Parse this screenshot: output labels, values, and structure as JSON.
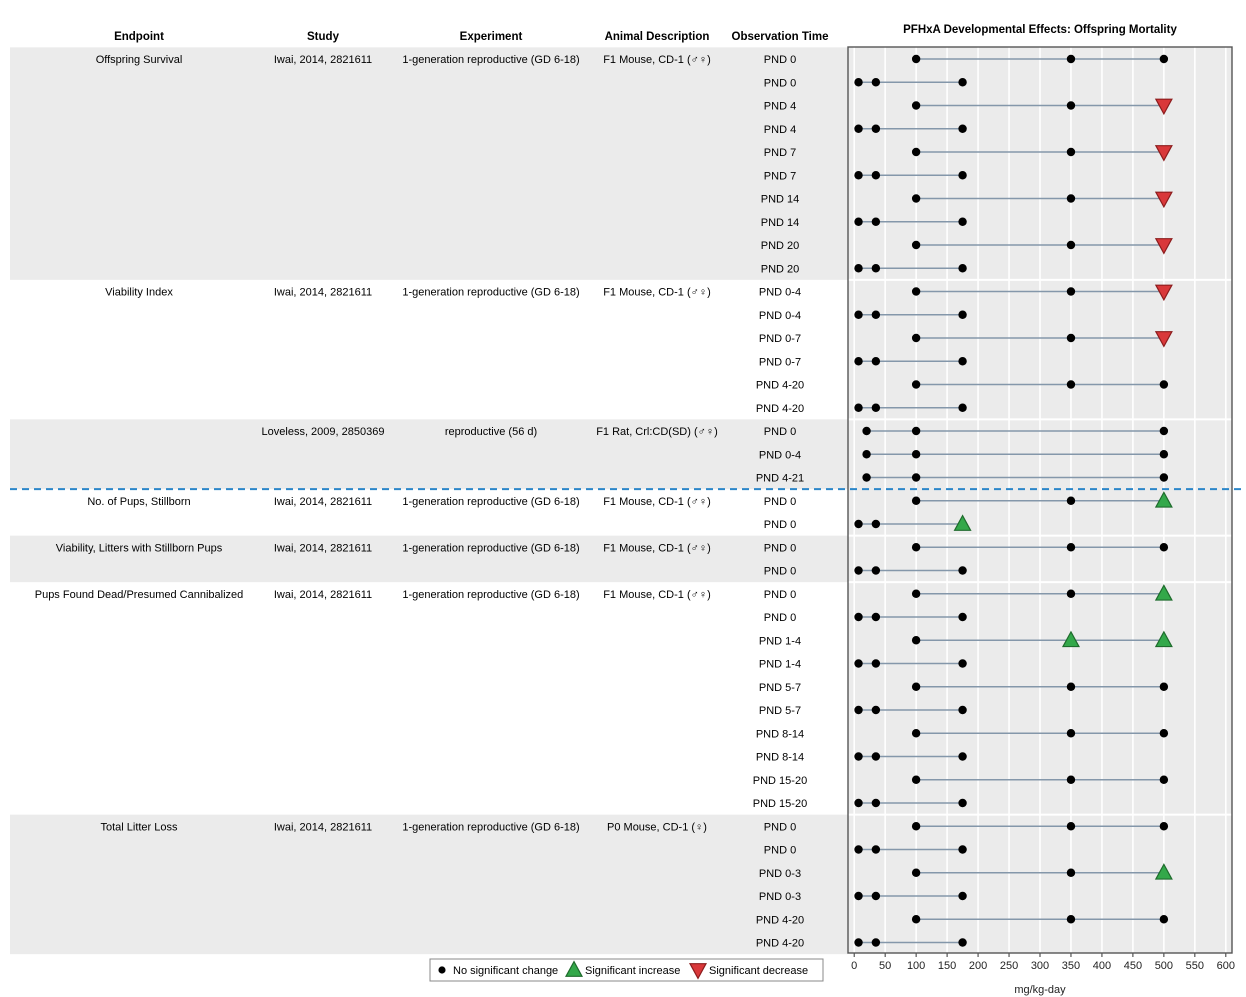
{
  "chart_data": {
    "type": "scatter",
    "subtype": "exposure-response array",
    "title": "PFHxA Developmental Effects: Offspring Mortality",
    "xlabel": "mg/kg-day",
    "xlim": [
      -10,
      610
    ],
    "xticks": [
      0,
      50,
      100,
      150,
      200,
      250,
      300,
      350,
      400,
      450,
      500,
      550,
      600
    ],
    "grid": true,
    "legend_position": "bottom-center",
    "columns": [
      "Endpoint",
      "Study",
      "Experiment",
      "Animal Description",
      "Observation Time"
    ],
    "symbols": {
      "none": {
        "label": "No significant change",
        "color": "#000000"
      },
      "up": {
        "label": "Significant increase",
        "color": "#2ca02c"
      },
      "down": {
        "label": "Significant decrease",
        "color": "#d62728"
      }
    },
    "series_order": [
      "none",
      "up",
      "down"
    ],
    "groups": [
      {
        "endpoint": "Offspring Survival",
        "study": "Iwai, 2014, 2821611",
        "experiment": "1-generation reproductive (GD 6-18)",
        "animal": "F1 Mouse, CD-1 (♂♀)",
        "shaded": true,
        "rows": [
          {
            "time": "PND 0",
            "doses": [
              100,
              350,
              500
            ],
            "effects": [
              "none",
              "none",
              "none"
            ]
          },
          {
            "time": "PND 0",
            "doses": [
              7,
              35,
              175
            ],
            "effects": [
              "none",
              "none",
              "none"
            ]
          },
          {
            "time": "PND 4",
            "doses": [
              100,
              350,
              500
            ],
            "effects": [
              "none",
              "none",
              "down"
            ]
          },
          {
            "time": "PND 4",
            "doses": [
              7,
              35,
              175
            ],
            "effects": [
              "none",
              "none",
              "none"
            ]
          },
          {
            "time": "PND 7",
            "doses": [
              100,
              350,
              500
            ],
            "effects": [
              "none",
              "none",
              "down"
            ]
          },
          {
            "time": "PND 7",
            "doses": [
              7,
              35,
              175
            ],
            "effects": [
              "none",
              "none",
              "none"
            ]
          },
          {
            "time": "PND 14",
            "doses": [
              100,
              350,
              500
            ],
            "effects": [
              "none",
              "none",
              "down"
            ]
          },
          {
            "time": "PND 14",
            "doses": [
              7,
              35,
              175
            ],
            "effects": [
              "none",
              "none",
              "none"
            ]
          },
          {
            "time": "PND 20",
            "doses": [
              100,
              350,
              500
            ],
            "effects": [
              "none",
              "none",
              "down"
            ]
          },
          {
            "time": "PND 20",
            "doses": [
              7,
              35,
              175
            ],
            "effects": [
              "none",
              "none",
              "none"
            ]
          }
        ]
      },
      {
        "endpoint": "Viability Index",
        "study": "Iwai, 2014, 2821611",
        "experiment": "1-generation reproductive (GD 6-18)",
        "animal": "F1 Mouse, CD-1 (♂♀)",
        "shaded": false,
        "rows": [
          {
            "time": "PND 0-4",
            "doses": [
              100,
              350,
              500
            ],
            "effects": [
              "none",
              "none",
              "down"
            ]
          },
          {
            "time": "PND 0-4",
            "doses": [
              7,
              35,
              175
            ],
            "effects": [
              "none",
              "none",
              "none"
            ]
          },
          {
            "time": "PND 0-7",
            "doses": [
              100,
              350,
              500
            ],
            "effects": [
              "none",
              "none",
              "down"
            ]
          },
          {
            "time": "PND 0-7",
            "doses": [
              7,
              35,
              175
            ],
            "effects": [
              "none",
              "none",
              "none"
            ]
          },
          {
            "time": "PND 4-20",
            "doses": [
              100,
              350,
              500
            ],
            "effects": [
              "none",
              "none",
              "none"
            ]
          },
          {
            "time": "PND 4-20",
            "doses": [
              7,
              35,
              175
            ],
            "effects": [
              "none",
              "none",
              "none"
            ]
          }
        ]
      },
      {
        "endpoint": "",
        "study": "Loveless, 2009, 2850369",
        "experiment": "reproductive (56 d)",
        "animal": "F1 Rat, Crl:CD(SD) (♂♀)",
        "shaded": true,
        "rows": [
          {
            "time": "PND 0",
            "doses": [
              20,
              100,
              500
            ],
            "effects": [
              "none",
              "none",
              "none"
            ]
          },
          {
            "time": "PND 0-4",
            "doses": [
              20,
              100,
              500
            ],
            "effects": [
              "none",
              "none",
              "none"
            ]
          },
          {
            "time": "PND 4-21",
            "doses": [
              20,
              100,
              500
            ],
            "effects": [
              "none",
              "none",
              "none"
            ]
          }
        ]
      },
      {
        "endpoint": "No. of Pups, Stillborn",
        "study": "Iwai, 2014, 2821611",
        "experiment": "1-generation reproductive (GD 6-18)",
        "animal": "F1 Mouse, CD-1 (♂♀)",
        "shaded": false,
        "separator_above": true,
        "rows": [
          {
            "time": "PND 0",
            "doses": [
              100,
              350,
              500
            ],
            "effects": [
              "none",
              "none",
              "up"
            ]
          },
          {
            "time": "PND 0",
            "doses": [
              7,
              35,
              175
            ],
            "effects": [
              "none",
              "none",
              "up"
            ]
          }
        ]
      },
      {
        "endpoint": "Viability, Litters with Stillborn Pups",
        "study": "Iwai, 2014, 2821611",
        "experiment": "1-generation reproductive (GD 6-18)",
        "animal": "F1 Mouse, CD-1 (♂♀)",
        "shaded": true,
        "rows": [
          {
            "time": "PND 0",
            "doses": [
              100,
              350,
              500
            ],
            "effects": [
              "none",
              "none",
              "none"
            ]
          },
          {
            "time": "PND 0",
            "doses": [
              7,
              35,
              175
            ],
            "effects": [
              "none",
              "none",
              "none"
            ]
          }
        ]
      },
      {
        "endpoint": "Pups Found Dead/Presumed Cannibalized",
        "study": "Iwai, 2014, 2821611",
        "experiment": "1-generation reproductive (GD 6-18)",
        "animal": "F1 Mouse, CD-1 (♂♀)",
        "shaded": false,
        "rows": [
          {
            "time": "PND 0",
            "doses": [
              100,
              350,
              500
            ],
            "effects": [
              "none",
              "none",
              "up"
            ]
          },
          {
            "time": "PND 0",
            "doses": [
              7,
              35,
              175
            ],
            "effects": [
              "none",
              "none",
              "none"
            ]
          },
          {
            "time": "PND 1-4",
            "doses": [
              100,
              350,
              500
            ],
            "effects": [
              "none",
              "up",
              "up"
            ]
          },
          {
            "time": "PND 1-4",
            "doses": [
              7,
              35,
              175
            ],
            "effects": [
              "none",
              "none",
              "none"
            ]
          },
          {
            "time": "PND 5-7",
            "doses": [
              100,
              350,
              500
            ],
            "effects": [
              "none",
              "none",
              "none"
            ]
          },
          {
            "time": "PND 5-7",
            "doses": [
              7,
              35,
              175
            ],
            "effects": [
              "none",
              "none",
              "none"
            ]
          },
          {
            "time": "PND 8-14",
            "doses": [
              100,
              350,
              500
            ],
            "effects": [
              "none",
              "none",
              "none"
            ]
          },
          {
            "time": "PND 8-14",
            "doses": [
              7,
              35,
              175
            ],
            "effects": [
              "none",
              "none",
              "none"
            ]
          },
          {
            "time": "PND 15-20",
            "doses": [
              100,
              350,
              500
            ],
            "effects": [
              "none",
              "none",
              "none"
            ]
          },
          {
            "time": "PND 15-20",
            "doses": [
              7,
              35,
              175
            ],
            "effects": [
              "none",
              "none",
              "none"
            ]
          }
        ]
      },
      {
        "endpoint": "Total Litter Loss",
        "study": "Iwai, 2014, 2821611",
        "experiment": "1-generation reproductive (GD 6-18)",
        "animal": "P0 Mouse, CD-1 (♀)",
        "shaded": true,
        "rows": [
          {
            "time": "PND 0",
            "doses": [
              100,
              350,
              500
            ],
            "effects": [
              "none",
              "none",
              "none"
            ]
          },
          {
            "time": "PND 0",
            "doses": [
              7,
              35,
              175
            ],
            "effects": [
              "none",
              "none",
              "none"
            ]
          },
          {
            "time": "PND 0-3",
            "doses": [
              100,
              350,
              500
            ],
            "effects": [
              "none",
              "none",
              "up"
            ]
          },
          {
            "time": "PND 0-3",
            "doses": [
              7,
              35,
              175
            ],
            "effects": [
              "none",
              "none",
              "none"
            ]
          },
          {
            "time": "PND 4-20",
            "doses": [
              100,
              350,
              500
            ],
            "effects": [
              "none",
              "none",
              "none"
            ]
          },
          {
            "time": "PND 4-20",
            "doses": [
              7,
              35,
              175
            ],
            "effects": [
              "none",
              "none",
              "none"
            ]
          }
        ]
      }
    ]
  }
}
